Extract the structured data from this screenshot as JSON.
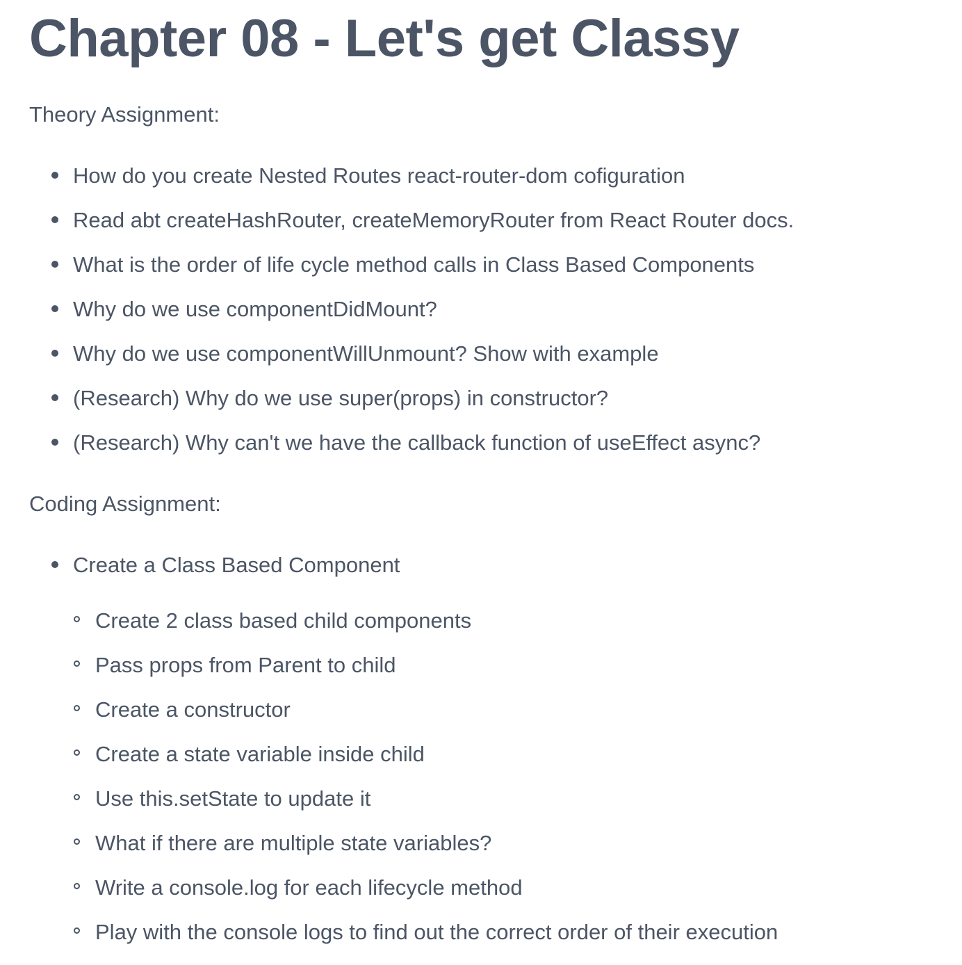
{
  "title": "Chapter 08 - Let's get Classy",
  "theory": {
    "label": "Theory Assignment:",
    "items": [
      "How do you create Nested Routes react-router-dom cofiguration",
      "Read abt createHashRouter, createMemoryRouter from React Router docs.",
      "What is the order of life cycle method calls in Class Based Components",
      "Why do we use componentDidMount?",
      "Why do we use componentWillUnmount? Show with example",
      "(Research) Why do we use super(props) in constructor?",
      "(Research) Why can't we have the callback function of useEffect async?"
    ]
  },
  "coding": {
    "label": "Coding Assignment:",
    "items": [
      "Create a Class Based Component"
    ],
    "subitems": [
      "Create 2 class based child components",
      "Pass props from Parent to child",
      "Create a constructor",
      "Create a state variable inside child",
      "Use this.setState to update it",
      "What if there are multiple state variables?",
      "Write a console.log for each lifecycle method",
      "Play with the console logs to find out the correct order of their execution"
    ]
  }
}
